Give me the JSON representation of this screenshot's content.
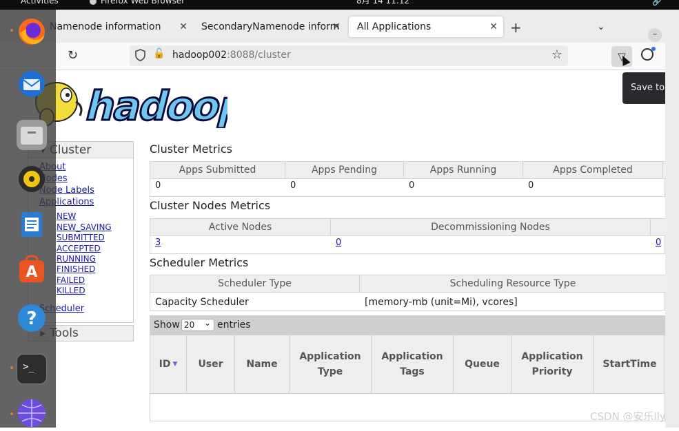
{
  "topbar": {
    "activities": "Activities",
    "focused_app": "Firefox Web Browser",
    "clock": "8月 14  11:12"
  },
  "browser": {
    "tabs": [
      {
        "label": "Namenode information"
      },
      {
        "label": "SecondaryNamenode inform"
      },
      {
        "label": "All Applications"
      }
    ],
    "url_host": "hadoop002",
    "url_path": ":8088/cluster",
    "tooltip": "Save to"
  },
  "sidebar": {
    "cluster_title": "Cluster",
    "items": [
      "About",
      "Nodes",
      "Node Labels",
      "Applications"
    ],
    "app_states": [
      "NEW",
      "NEW_SAVING",
      "SUBMITTED",
      "ACCEPTED",
      "RUNNING",
      "FINISHED",
      "FAILED",
      "KILLED"
    ],
    "scheduler": "Scheduler",
    "tools_title": "Tools"
  },
  "cluster_metrics": {
    "title": "Cluster Metrics",
    "headers": [
      "Apps Submitted",
      "Apps Pending",
      "Apps Running",
      "Apps Completed"
    ],
    "values": [
      "0",
      "0",
      "0",
      "0"
    ]
  },
  "node_metrics": {
    "title": "Cluster Nodes Metrics",
    "headers": [
      "Active Nodes",
      "Decommissioning Nodes"
    ],
    "values": [
      "3",
      "0",
      "0"
    ]
  },
  "scheduler_metrics": {
    "title": "Scheduler Metrics",
    "headers": [
      "Scheduler Type",
      "Scheduling Resource Type"
    ],
    "values": [
      "Capacity Scheduler",
      "[memory-mb (unit=Mi), vcores]"
    ]
  },
  "apps_table": {
    "show_label": "Show",
    "page_size": "20",
    "entries_label": "entries",
    "columns": [
      "ID",
      "User",
      "Name",
      "Application Type",
      "Application Tags",
      "Queue",
      "Application Priority",
      "StartTime"
    ],
    "sort_indicator": "▼"
  },
  "watermark": "CSDN @安乐lly"
}
